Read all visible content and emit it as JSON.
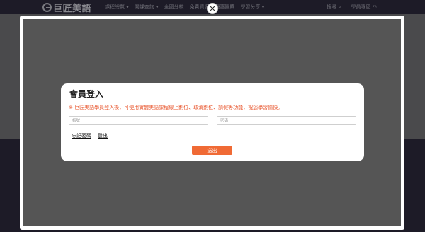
{
  "site": {
    "logo_text": "巨匠美語",
    "nav_items": [
      "課程總覽 ▾",
      "開課查詢 ▾",
      "全國分校",
      "免費資源",
      "優惠團購",
      "學習分享 ▾"
    ],
    "search_label": "搜尋",
    "member_area_label": "學員專區"
  },
  "lightbox": {
    "close_label": "✕"
  },
  "login": {
    "title": "會員登入",
    "notice": "※ 巨匠美語學員登入後，可使用實體美語課程線上劃位、取消劃位、請假等功能，祝您學習愉快。",
    "account_placeholder": "帳號",
    "password_placeholder": "密碼",
    "forgot_password_label": "忘記密碼",
    "logout_label": "登出",
    "submit_label": "送出"
  }
}
